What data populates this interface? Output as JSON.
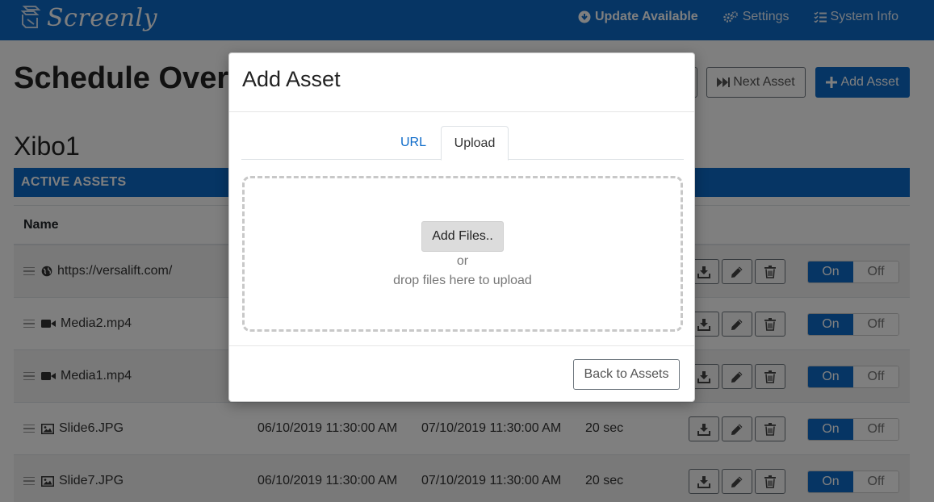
{
  "navbar": {
    "brand": "Screenly",
    "links": [
      {
        "label": "Update Available",
        "icon": "arrow-circle-down-icon"
      },
      {
        "label": "Settings",
        "icon": "gears-icon"
      },
      {
        "label": "System Info",
        "icon": "tasks-icon"
      }
    ]
  },
  "page": {
    "title": "Schedule Overview",
    "next_asset": "Next Asset",
    "add_asset": "Add Asset",
    "device": "Xibo1",
    "section": "ACTIVE ASSETS",
    "col_name": "Name"
  },
  "rows": [
    {
      "name": "https://versalift.com/",
      "icon": "globe-icon",
      "start": "",
      "end": "",
      "duration": "",
      "toggle_on": "On",
      "toggle_off": "Off"
    },
    {
      "name": "Media2.mp4",
      "icon": "video-icon",
      "start": "",
      "end": "",
      "duration": "",
      "toggle_on": "On",
      "toggle_off": "Off"
    },
    {
      "name": "Media1.mp4",
      "icon": "video-icon",
      "start": "",
      "end": "",
      "duration": "",
      "toggle_on": "On",
      "toggle_off": "Off"
    },
    {
      "name": "Slide6.JPG",
      "icon": "image-icon",
      "start": "06/10/2019 11:30:00 AM",
      "end": "07/10/2019 11:30:00 AM",
      "duration": "20 sec",
      "toggle_on": "On",
      "toggle_off": "Off"
    },
    {
      "name": "Slide7.JPG",
      "icon": "image-icon",
      "start": "06/10/2019 11:30:00 AM",
      "end": "07/10/2019 11:30:00 AM",
      "duration": "20 sec",
      "toggle_on": "On",
      "toggle_off": "Off"
    }
  ],
  "modal": {
    "title": "Add Asset",
    "tabs": [
      "URL",
      "Upload"
    ],
    "active_tab": "Upload",
    "add_files": "Add Files..",
    "or": "or",
    "drop_hint": "drop files here to upload",
    "back": "Back to Assets"
  },
  "colors": {
    "primary": "#0d6bc9",
    "stripe": "#f2f2f2"
  }
}
